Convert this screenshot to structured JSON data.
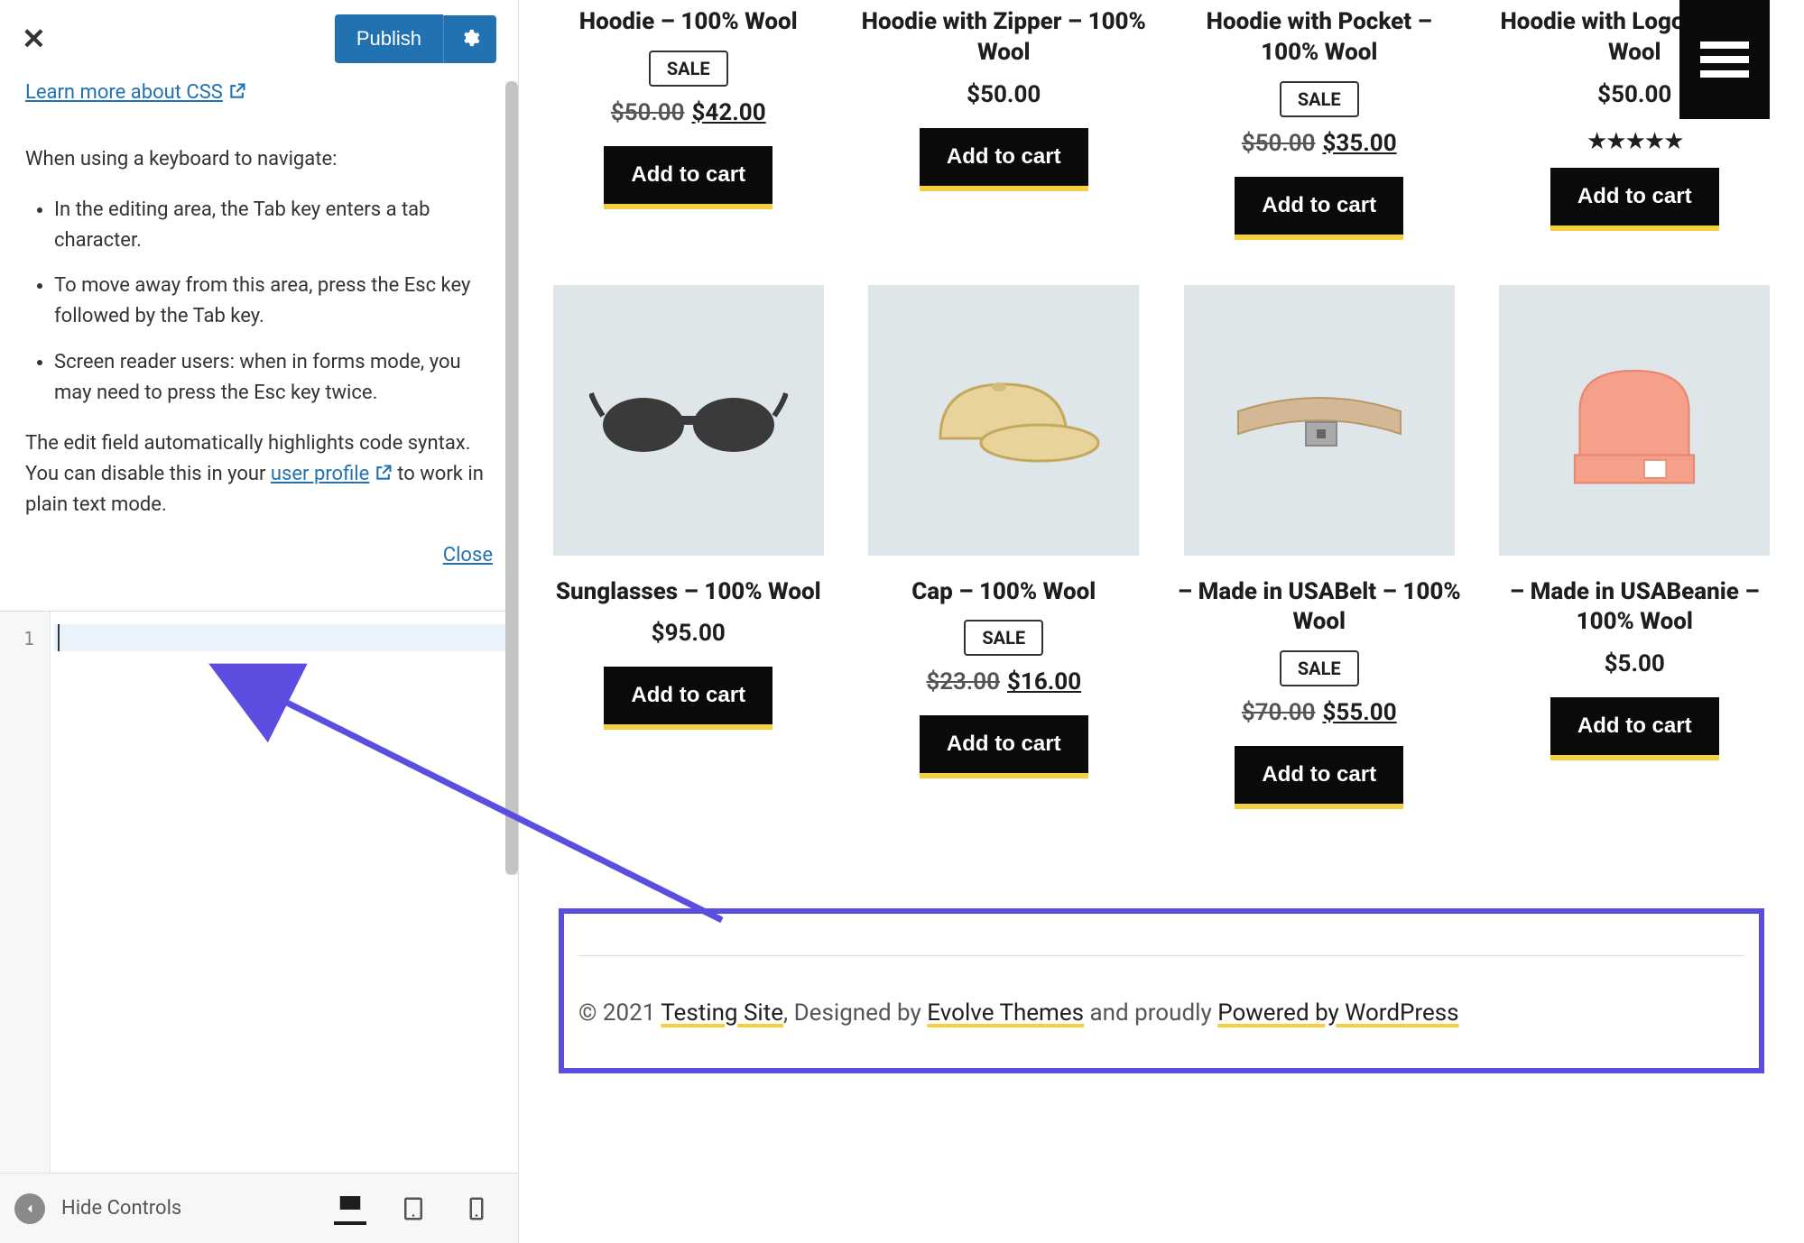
{
  "sidebar": {
    "publish_label": "Publish",
    "learn_more": "Learn more about CSS",
    "keyboard_intro": "When using a keyboard to navigate:",
    "bullets": [
      "In the editing area, the Tab key enters a tab character.",
      "To move away from this area, press the Esc key followed by the Tab key.",
      "Screen reader users: when in forms mode, you may need to press the Esc key twice."
    ],
    "syntax_text_1": "The edit field automatically highlights code syntax. You can disable this in your ",
    "user_profile_link": "user profile",
    "syntax_text_2": " to work in plain text mode.",
    "close_label": "Close",
    "line_number": "1",
    "hide_controls": "Hide Controls"
  },
  "products_row1": [
    {
      "title": "Hoodie – 100% Wool",
      "sale": true,
      "old_price": "$50.00",
      "new_price": "$42.00",
      "rating": false,
      "btn": "Add to cart"
    },
    {
      "title": "Hoodie with Zipper – 100% Wool",
      "sale": false,
      "price": "$50.00",
      "rating": false,
      "btn": "Add to cart"
    },
    {
      "title": "Hoodie with Pocket – 100% Wool",
      "sale": true,
      "old_price": "$50.00",
      "new_price": "$35.00",
      "rating": false,
      "btn": "Add to cart"
    },
    {
      "title": "Hoodie with Logo – 100% Wool",
      "sale": false,
      "price": "$50.00",
      "rating": true,
      "btn": "Add to cart"
    }
  ],
  "products_row2": [
    {
      "title": "Sunglasses – 100% Wool",
      "sale": false,
      "price": "$95.00",
      "btn": "Add to cart"
    },
    {
      "title": "Cap – 100% Wool",
      "sale": true,
      "old_price": "$23.00",
      "new_price": "$16.00",
      "btn": "Add to cart"
    },
    {
      "title": "– Made in USABelt – 100% Wool",
      "sale": true,
      "old_price": "$70.00",
      "new_price": "$55.00",
      "btn": "Add to cart"
    },
    {
      "title": "– Made in USABeanie – 100% Wool",
      "sale": false,
      "price": "$5.00",
      "btn": "Add to cart"
    }
  ],
  "sale_label": "SALE",
  "footer": {
    "copyright": "© 2021 ",
    "site_link": "Testing Site",
    "designed_by": ", Designed by ",
    "theme_link": "Evolve Themes",
    "proudly": " and proudly ",
    "powered_link": "Powered by WordPress"
  }
}
